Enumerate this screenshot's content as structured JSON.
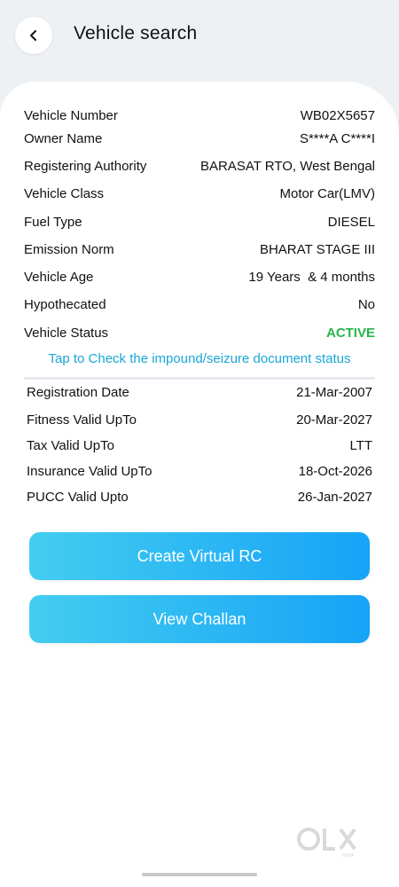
{
  "header": {
    "title": "Vehicle search",
    "back_icon": "chevron-left-icon"
  },
  "details": [
    {
      "label": "Vehicle Number",
      "value": "WB02X5657"
    },
    {
      "label": "Owner Name",
      "value": "S****A C****I"
    },
    {
      "label": "Registering Authority",
      "value": "BARASAT RTO, West Bengal"
    },
    {
      "label": "Vehicle Class",
      "value": "Motor Car(LMV)"
    },
    {
      "label": "Fuel Type",
      "value": "DIESEL"
    },
    {
      "label": "Emission Norm",
      "value": "BHARAT STAGE III"
    },
    {
      "label": "Vehicle Age",
      "value": "19 Years  & 4 months"
    },
    {
      "label": "Hypothecated",
      "value": "No"
    },
    {
      "label": "Vehicle Status",
      "value": "ACTIVE"
    }
  ],
  "impound_link": "Tap to Check the impound/seizure document status",
  "validity": [
    {
      "label": "Registration Date",
      "value": "21-Mar-2007"
    },
    {
      "label": "Fitness Valid UpTo",
      "value": "20-Mar-2027"
    },
    {
      "label": "Tax Valid UpTo",
      "value": "LTT"
    },
    {
      "label": "Insurance Valid UpTo",
      "value": "18-Oct-2026"
    },
    {
      "label": "PUCC Valid Upto",
      "value": "26-Jan-2027"
    }
  ],
  "buttons": {
    "virtual_rc": "Create Virtual RC",
    "view_challan": "View Challan"
  },
  "watermark": {
    "text": "OLX",
    "sub": "INDIA"
  },
  "colors": {
    "status_active": "#27b54a",
    "link": "#1aa6d8",
    "button_start": "#43cdf0",
    "button_end": "#17a3f7"
  }
}
